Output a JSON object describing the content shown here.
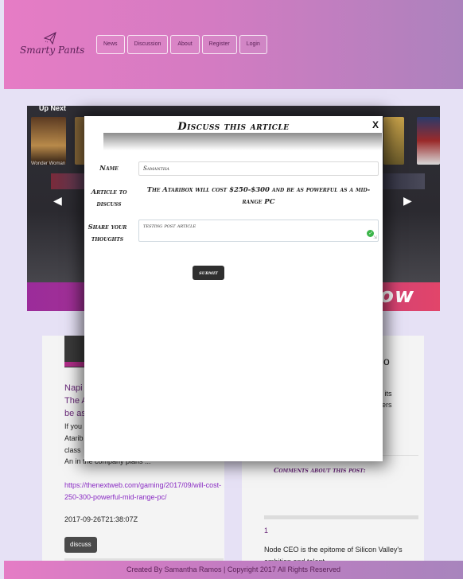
{
  "brand": {
    "name": "Smarty Pants",
    "icon": "paper-plane-icon"
  },
  "nav": {
    "items": [
      {
        "label": "News"
      },
      {
        "label": "Discussion"
      },
      {
        "label": "About"
      },
      {
        "label": "Register"
      },
      {
        "label": "Login"
      }
    ]
  },
  "carousel": {
    "up_next_label": "Up Next",
    "first_caption": "Wonder Woman",
    "banner_word": "now",
    "prev_icon": "chevron-left-icon",
    "next_icon": "chevron-right-icon"
  },
  "left_card": {
    "title_lines": [
      "Napi",
      "The A",
      "be as"
    ],
    "desc_partial": "If you Atarib class",
    "desc_rest": "An in the company plans ...",
    "link": "https://thenextweb.com/gaming/2017/09/will-cost-250-300-powerful-mid-range-pc/",
    "date": "2017-09-26T21:38:07Z",
    "discuss_label": "discuss"
  },
  "right_card": {
    "frag_1": "g its",
    "frag_2": "ers",
    "frag_3": "o",
    "comments_heading": "Comments about this post:",
    "comment_number": "1",
    "comment_text": "Node CEO is the epitome of Silicon Valley's ambition and talent"
  },
  "modal": {
    "title": "Discuss this article",
    "close_label": "X",
    "name_label": "Name",
    "name_value": "Samantha",
    "article_label": "Article to discuss",
    "article_value": "The Ataribox will cost $250-$300 and be as powerful as a mid-range PC",
    "thoughts_label": "Share your thoughts",
    "thoughts_value": "testing post article",
    "submit_label": "submit"
  },
  "footer": {
    "text": "Created By Samantha Ramos | Copyright 2017 All Rights Reserved"
  }
}
